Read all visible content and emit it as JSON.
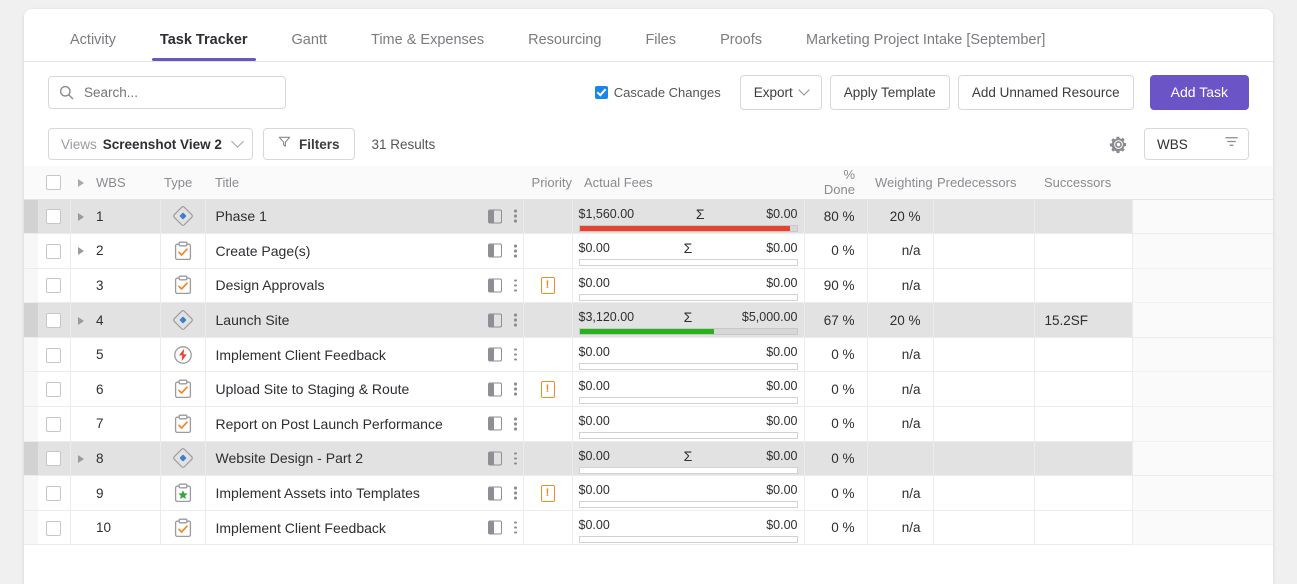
{
  "tabs": [
    {
      "label": "Activity",
      "active": false
    },
    {
      "label": "Task Tracker",
      "active": true
    },
    {
      "label": "Gantt",
      "active": false
    },
    {
      "label": "Time & Expenses",
      "active": false
    },
    {
      "label": "Resourcing",
      "active": false
    },
    {
      "label": "Files",
      "active": false
    },
    {
      "label": "Proofs",
      "active": false
    },
    {
      "label": "Marketing Project Intake [September]",
      "active": false
    }
  ],
  "search": {
    "placeholder": "Search...",
    "value": ""
  },
  "toolbar": {
    "cascade_label": "Cascade Changes",
    "cascade_checked": true,
    "export_label": "Export",
    "apply_template_label": "Apply Template",
    "add_unnamed_resource_label": "Add Unnamed Resource",
    "add_task_label": "Add Task"
  },
  "viewrow": {
    "views_label": "Views",
    "views_value": "Screenshot View 2",
    "filters_label": "Filters",
    "results_label": "31 Results",
    "wbs_value": "WBS"
  },
  "columns": {
    "wbs": "WBS",
    "type": "Type",
    "title": "Title",
    "priority": "Priority",
    "actual_fees": "Actual Fees",
    "pct_done": "% Done",
    "weighting": "Weighting",
    "predecessors": "Predecessors",
    "successors": "Successors"
  },
  "accent_colors": {
    "primary": "#6b54c6",
    "bar_over": "#e8412c",
    "bar_ok": "#25b21a",
    "priority": "#f08a24",
    "checkbox_checked": "#1a87e8"
  },
  "rows": [
    {
      "wbs": "1",
      "type_icon": "milestone-diamond-icon",
      "title": "Phase 1",
      "parent": true,
      "expandable": true,
      "priority": false,
      "fee_left": "$1,560.00",
      "sigma": true,
      "fee_right": "$0.00",
      "bar_pct": 97,
      "bar_color": "#e8412c",
      "pct_done": "80 %",
      "weighting": "20 %",
      "weighting_na": false,
      "predecessors": "",
      "successors": ""
    },
    {
      "wbs": "2",
      "type_icon": "task-clipboard-icon",
      "title": "Create Page(s)",
      "parent": false,
      "expandable": true,
      "priority": false,
      "fee_left": "$0.00",
      "sigma": true,
      "fee_right": "$0.00",
      "bar_pct": 0,
      "bar_color": "#e8412c",
      "pct_done": "0 %",
      "weighting": "n/a",
      "weighting_na": true,
      "predecessors": "",
      "successors": ""
    },
    {
      "wbs": "3",
      "type_icon": "task-clipboard-icon",
      "title": "Design Approvals",
      "parent": false,
      "expandable": false,
      "priority": true,
      "fee_left": "$0.00",
      "sigma": false,
      "fee_right": "$0.00",
      "bar_pct": 0,
      "bar_color": "#e8412c",
      "pct_done": "90 %",
      "weighting": "n/a",
      "weighting_na": true,
      "predecessors": "",
      "successors": ""
    },
    {
      "wbs": "4",
      "type_icon": "milestone-diamond-icon",
      "title": "Launch Site",
      "parent": true,
      "expandable": true,
      "priority": false,
      "fee_left": "$3,120.00",
      "sigma": true,
      "fee_right": "$5,000.00",
      "bar_pct": 62,
      "bar_color": "#25b21a",
      "pct_done": "67 %",
      "weighting": "20 %",
      "weighting_na": false,
      "predecessors": "",
      "successors": "15.2SF"
    },
    {
      "wbs": "5",
      "type_icon": "bolt-circle-icon",
      "title": "Implement Client Feedback",
      "parent": false,
      "expandable": false,
      "priority": false,
      "fee_left": "$0.00",
      "sigma": false,
      "fee_right": "$0.00",
      "bar_pct": 0,
      "bar_color": "#e8412c",
      "pct_done": "0 %",
      "weighting": "n/a",
      "weighting_na": true,
      "predecessors": "",
      "successors": ""
    },
    {
      "wbs": "6",
      "type_icon": "task-clipboard-icon",
      "title": "Upload Site to Staging & Route",
      "parent": false,
      "expandable": false,
      "priority": true,
      "fee_left": "$0.00",
      "sigma": false,
      "fee_right": "$0.00",
      "bar_pct": 0,
      "bar_color": "#e8412c",
      "pct_done": "0 %",
      "weighting": "n/a",
      "weighting_na": true,
      "predecessors": "",
      "successors": ""
    },
    {
      "wbs": "7",
      "type_icon": "task-clipboard-icon",
      "title": "Report on Post Launch Performance",
      "parent": false,
      "expandable": false,
      "priority": false,
      "fee_left": "$0.00",
      "sigma": false,
      "fee_right": "$0.00",
      "bar_pct": 0,
      "bar_color": "#e8412c",
      "pct_done": "0 %",
      "weighting": "n/a",
      "weighting_na": true,
      "predecessors": "",
      "successors": ""
    },
    {
      "wbs": "8",
      "type_icon": "milestone-diamond-icon",
      "title": "Website Design - Part 2",
      "parent": true,
      "expandable": true,
      "priority": false,
      "fee_left": "$0.00",
      "sigma": true,
      "fee_right": "$0.00",
      "bar_pct": 0,
      "bar_color": "#e8412c",
      "pct_done": "0 %",
      "weighting": "",
      "weighting_na": false,
      "predecessors": "",
      "successors": ""
    },
    {
      "wbs": "9",
      "type_icon": "deliverable-star-icon",
      "title": "Implement Assets into Templates",
      "parent": false,
      "expandable": false,
      "priority": true,
      "fee_left": "$0.00",
      "sigma": false,
      "fee_right": "$0.00",
      "bar_pct": 0,
      "bar_color": "#e8412c",
      "pct_done": "0 %",
      "weighting": "n/a",
      "weighting_na": true,
      "predecessors": "",
      "successors": ""
    },
    {
      "wbs": "10",
      "type_icon": "task-clipboard-icon",
      "title": "Implement Client Feedback",
      "parent": false,
      "expandable": false,
      "priority": false,
      "fee_left": "$0.00",
      "sigma": false,
      "fee_right": "$0.00",
      "bar_pct": 0,
      "bar_color": "#e8412c",
      "pct_done": "0 %",
      "weighting": "n/a",
      "weighting_na": true,
      "predecessors": "",
      "successors": ""
    }
  ]
}
